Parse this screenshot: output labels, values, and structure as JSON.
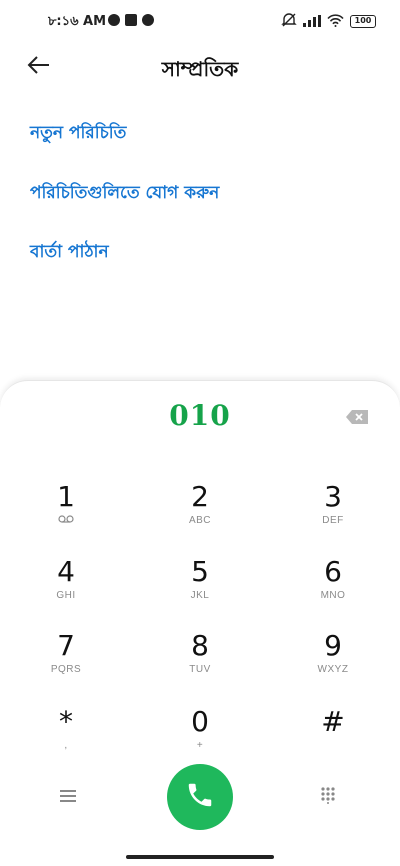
{
  "status_bar": {
    "time": "৮:১৬ AM",
    "battery": "100"
  },
  "header": {
    "title": "সাম্প্রতিক"
  },
  "actions": [
    {
      "label": "নতুন পরিচিতি"
    },
    {
      "label": "পরিচিতিগুলিতে যোগ করুন"
    },
    {
      "label": "বার্তা পাঠান"
    }
  ],
  "dialer": {
    "number": "010",
    "keys": [
      {
        "digit": "1",
        "letters": ""
      },
      {
        "digit": "2",
        "letters": "ABC"
      },
      {
        "digit": "3",
        "letters": "DEF"
      },
      {
        "digit": "4",
        "letters": "GHI"
      },
      {
        "digit": "5",
        "letters": "JKL"
      },
      {
        "digit": "6",
        "letters": "MNO"
      },
      {
        "digit": "7",
        "letters": "PQRS"
      },
      {
        "digit": "8",
        "letters": "TUV"
      },
      {
        "digit": "9",
        "letters": "WXYZ"
      },
      {
        "digit": "*",
        "letters": ","
      },
      {
        "digit": "0",
        "letters": "+"
      },
      {
        "digit": "#",
        "letters": ""
      }
    ]
  },
  "colors": {
    "accent_blue": "#1676d2",
    "dialed_green": "#16a34a",
    "call_green": "#1fb85c"
  },
  "icons": [
    "back-arrow-icon",
    "voicemail-icon",
    "backspace-icon",
    "menu-icon",
    "call-icon",
    "keypad-icon",
    "wifi-icon",
    "signal-icon",
    "mute-icon"
  ]
}
